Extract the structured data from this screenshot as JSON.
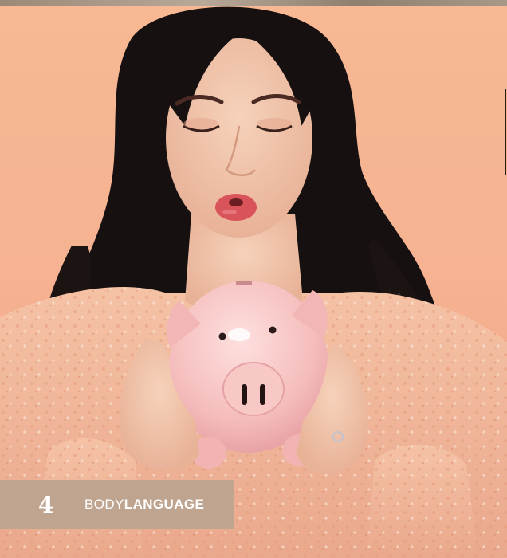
{
  "folio": {
    "page_number": "4",
    "section_light": "BODY",
    "section_bold": "LANGUAGE"
  },
  "colors": {
    "background": "#f6b392",
    "folio_band": "#bfa48f",
    "hair": "#161010",
    "piggy_bank": "#f7c4c4",
    "blouse": "#f1b99b",
    "skin": "#f2c2a8"
  }
}
